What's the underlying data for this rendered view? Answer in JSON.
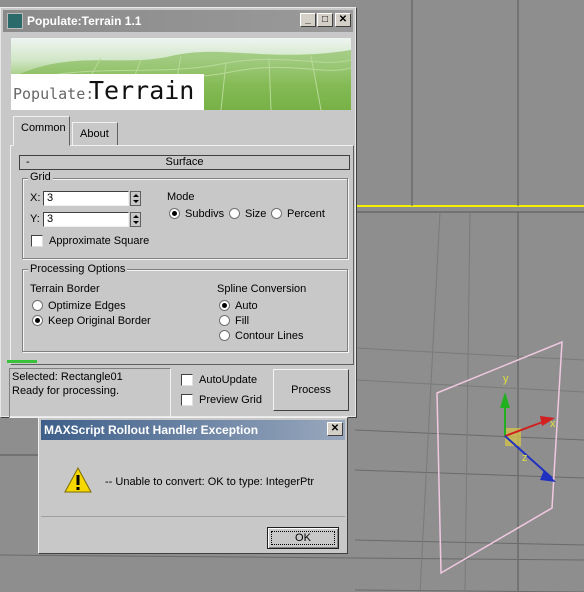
{
  "populate_window": {
    "title": "Populate:Terrain 1.1",
    "title_buttons": {
      "minimize": "_",
      "maximize": "□",
      "close": "✕"
    },
    "banner": {
      "prefix": "Populate:",
      "product": "Terrain"
    },
    "tabs": [
      {
        "label": "Common",
        "active": true
      },
      {
        "label": "About",
        "active": false
      }
    ],
    "rollout": {
      "toggle": "-",
      "title": "Surface"
    },
    "grid": {
      "title": "Grid",
      "x_label": "X:",
      "x_value": "3",
      "y_label": "Y:",
      "y_value": "3",
      "approx_square_label": "Approximate Square",
      "approx_square_checked": false
    },
    "mode": {
      "title": "Mode",
      "options": [
        {
          "label": "Subdivs",
          "selected": true
        },
        {
          "label": "Size",
          "selected": false
        },
        {
          "label": "Percent",
          "selected": false
        }
      ]
    },
    "processing": {
      "title": "Processing Options",
      "terrain_border": {
        "title": "Terrain Border",
        "options": [
          {
            "label": "Optimize Edges",
            "selected": false
          },
          {
            "label": "Keep Original Border",
            "selected": true
          }
        ]
      },
      "spline_conversion": {
        "title": "Spline Conversion",
        "options": [
          {
            "label": "Auto",
            "selected": true
          },
          {
            "label": "Fill",
            "selected": false
          },
          {
            "label": "Contour Lines",
            "selected": false
          }
        ]
      }
    },
    "status": {
      "selected": "Selected: Rectangle01",
      "message": "Ready for processing."
    },
    "auto_update_label": "AutoUpdate",
    "preview_grid_label": "Preview Grid",
    "process_label": "Process"
  },
  "error_dialog": {
    "title": "MAXScript Rollout Handler Exception",
    "close": "✕",
    "message": "-- Unable to convert: OK to type: IntegerPtr",
    "ok_label": "OK"
  },
  "viewport": {
    "axis_x": "x",
    "axis_y": "y",
    "axis_z": "z"
  },
  "colors": {
    "dialog_bg": "#c8c8c8",
    "viewport_bg": "#8e8e8e",
    "selected_highlight": "#ffff00",
    "error_title_bar": "#3e5f8a"
  }
}
